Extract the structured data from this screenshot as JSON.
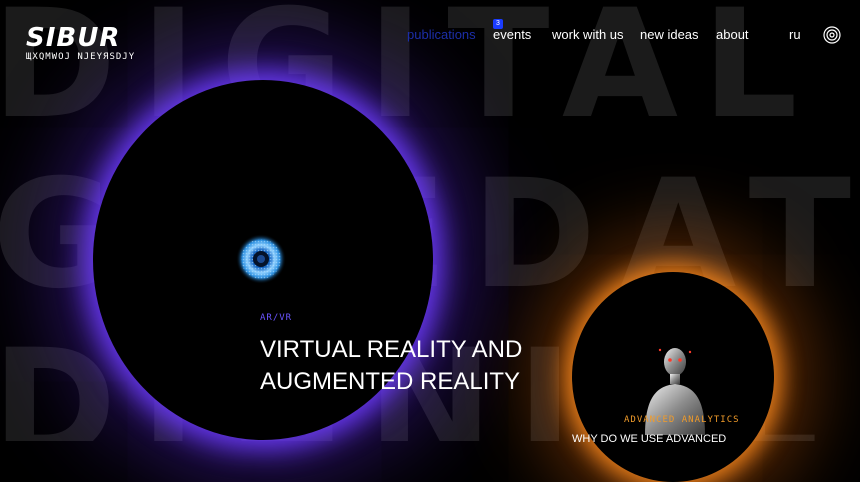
{
  "background": {
    "rows": [
      "DIGITAL",
      "GITEDATA",
      "DIGNITL"
    ]
  },
  "header": {
    "logo": "SIBUR",
    "logo_sub": "ЩХQМWОJ NJЕҮЯSDJҮ",
    "nav": [
      {
        "label": "publications",
        "active": true
      },
      {
        "label": "events",
        "badge": "3"
      },
      {
        "label": "work with us"
      },
      {
        "label": "new ideas"
      },
      {
        "label": "about"
      },
      {
        "label": "ru"
      }
    ],
    "menu_icon": "target-icon"
  },
  "cards": [
    {
      "tag": "AR/VR",
      "title": "VIRTUAL REALITY AND AUGMENTED REALITY",
      "accent": "#6b55ff",
      "icon": "eye-icon"
    },
    {
      "tag": "ADVANCED ANALYTICS",
      "title": "WHY DO WE USE ADVANCED",
      "accent": "#f09b2a",
      "icon": "humanoid-figure"
    }
  ],
  "colors": {
    "background": "#000000",
    "nav_active": "#1c2ea8",
    "badge": "#1a3cff",
    "purple_glow": "#6e3cff",
    "orange_glow": "#ff8c1e"
  }
}
